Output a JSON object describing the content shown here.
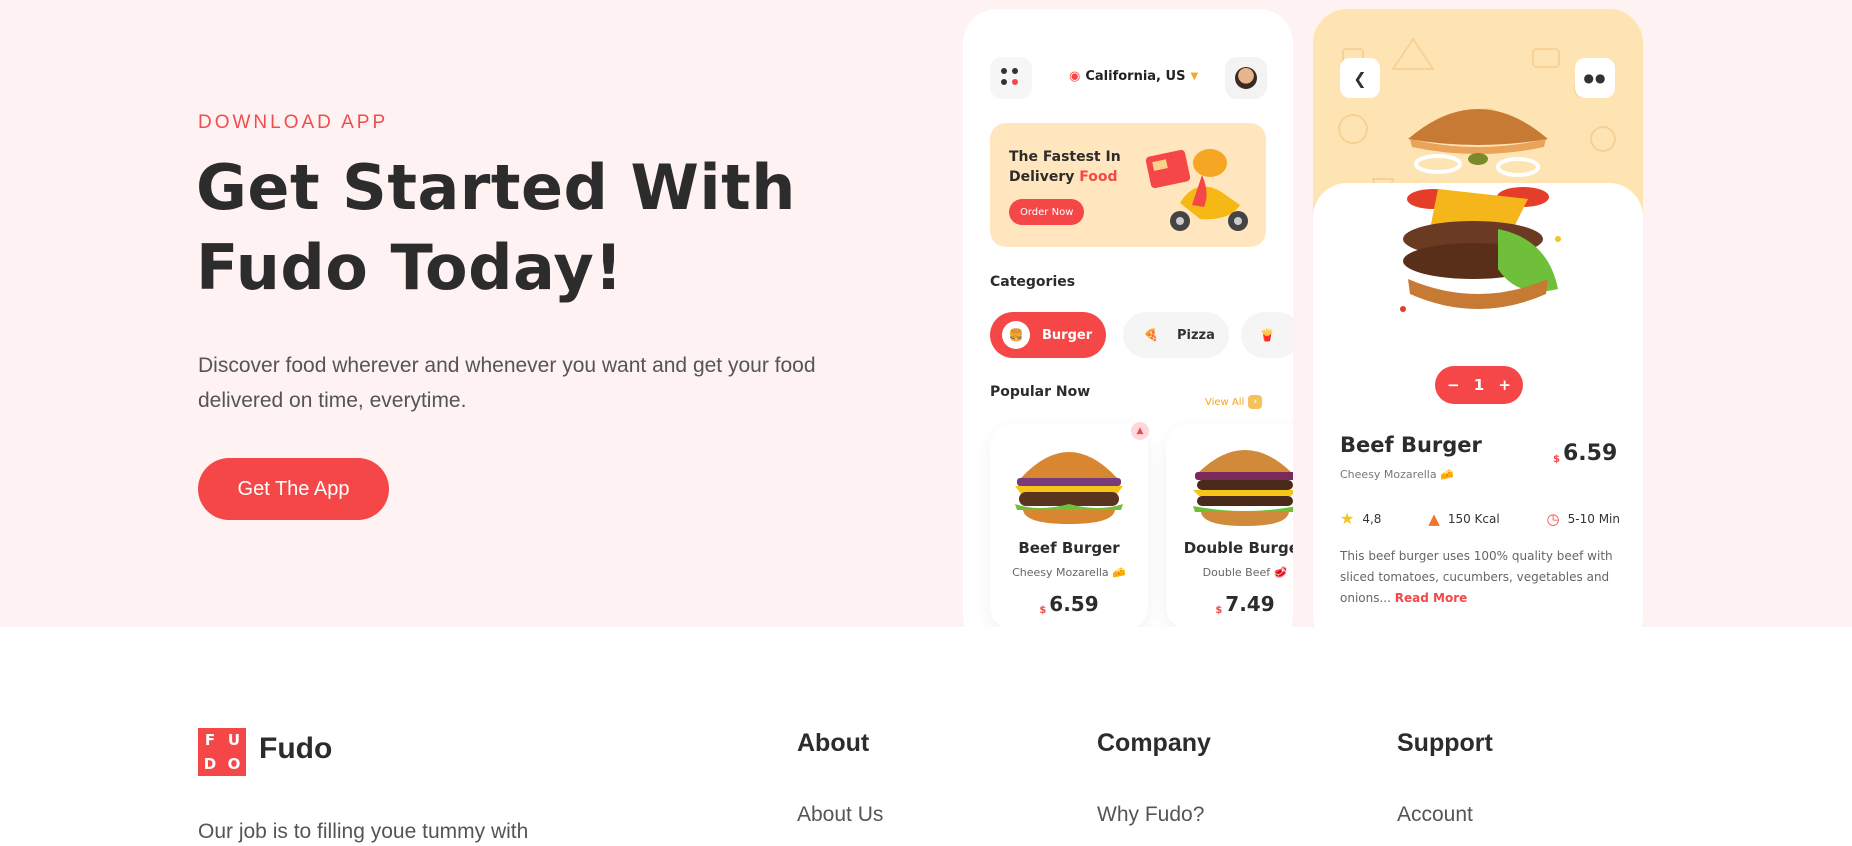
{
  "hero": {
    "eyebrow": "DOWNLOAD APP",
    "headline": "Get Started With Fudo Today!",
    "subtext": "Discover food wherever and whenever you want and get your food delivered on time, everytime.",
    "cta_label": "Get The App"
  },
  "phone_home": {
    "location": "California, US",
    "promo": {
      "title_line1": "The Fastest In",
      "title_line2": "Delivery",
      "title_highlight": "Food",
      "button": "Order Now"
    },
    "categories_title": "Categories",
    "categories": [
      {
        "label": "Burger",
        "icon": "burger-icon",
        "active": true
      },
      {
        "label": "Pizza",
        "icon": "pizza-icon",
        "active": false
      }
    ],
    "popular_title": "Popular Now",
    "view_all": "View All",
    "popular": [
      {
        "name": "Beef Burger",
        "desc": "Cheesy Mozarella",
        "currency": "$",
        "price": "6.59"
      },
      {
        "name": "Double Burger",
        "desc": "Double Beef",
        "currency": "$",
        "price": "7.49"
      }
    ]
  },
  "phone_detail": {
    "quantity": "1",
    "name": "Beef Burger",
    "currency": "$",
    "price": "6.59",
    "subtitle": "Cheesy Mozarella",
    "rating": "4,8",
    "calories": "150 Kcal",
    "time": "5-10 Min",
    "description": "This beef burger uses 100% quality beef with sliced tomatoes, cucumbers, vegetables and onions...",
    "read_more": "Read More"
  },
  "footer": {
    "brand": "Fudo",
    "logo_letters": [
      "F",
      "U",
      "D",
      "O"
    ],
    "tagline": "Our job is to filling youe tummy with",
    "columns": [
      {
        "title": "About",
        "first_link": "About Us"
      },
      {
        "title": "Company",
        "first_link": "Why Fudo?"
      },
      {
        "title": "Support",
        "first_link": "Account"
      }
    ]
  },
  "colors": {
    "accent": "#f54748",
    "hero_bg": "#fff2f2",
    "promo_bg": "#ffe6bf",
    "gold": "#f5a623"
  }
}
